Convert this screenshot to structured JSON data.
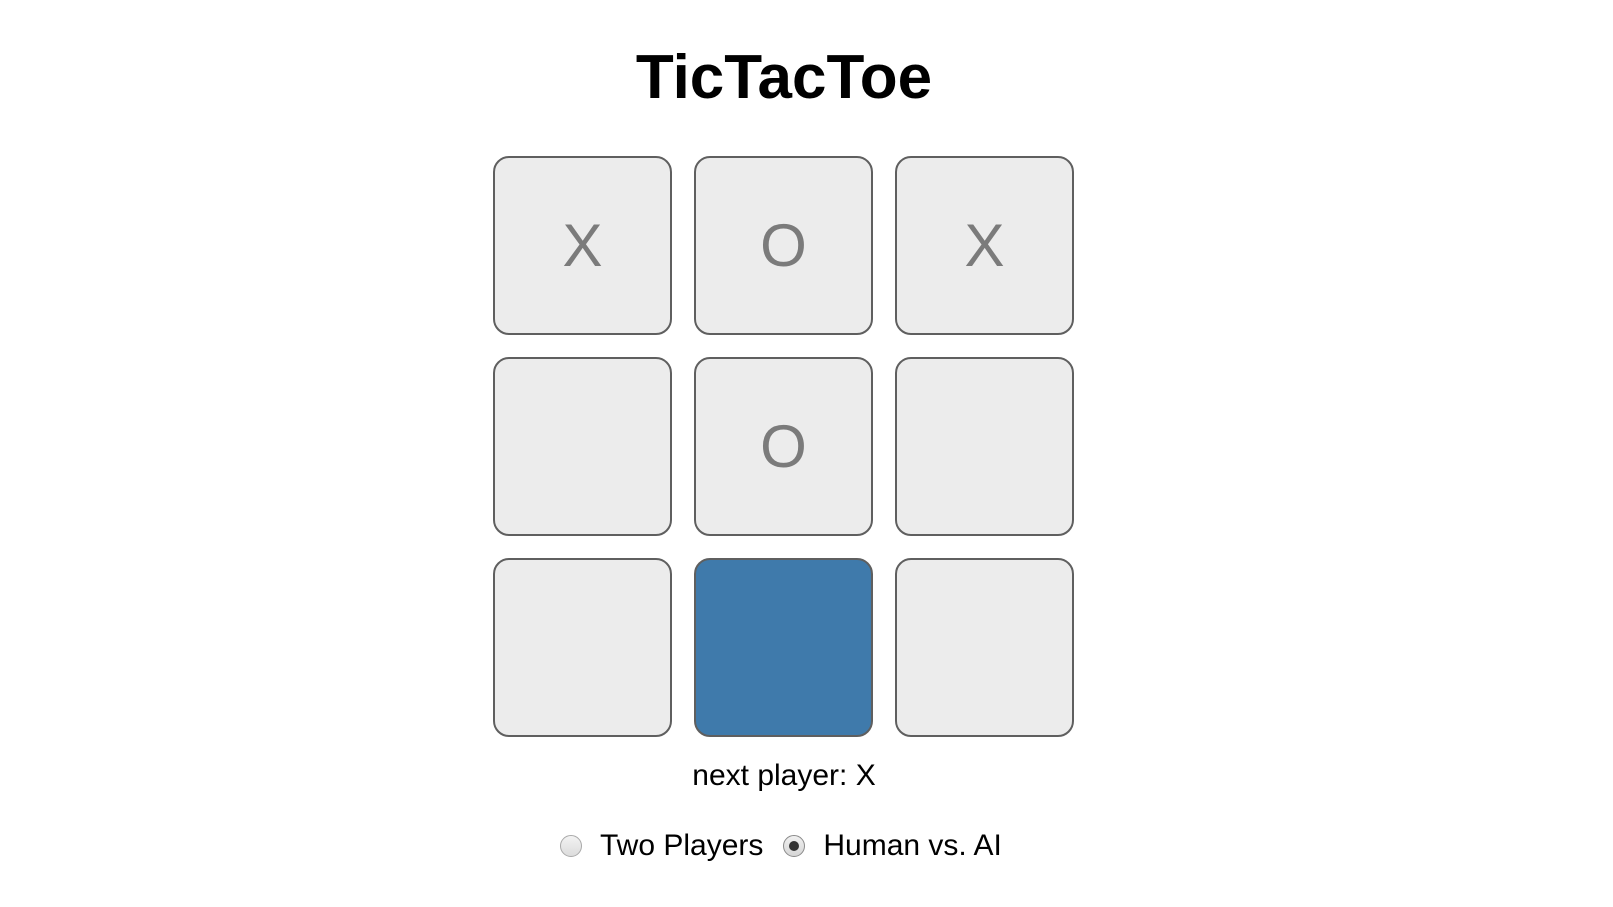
{
  "title": "TicTacToe",
  "board": {
    "cells": [
      "X",
      "O",
      "X",
      "",
      "O",
      "",
      "",
      "",
      ""
    ],
    "highlighted_cell": 7,
    "highlight_color": "#3f7aab",
    "cell_color": "#ececec",
    "mark_color": "#7b7b7b"
  },
  "status": {
    "text": "next player: X"
  },
  "modes": {
    "options": [
      {
        "label": "Two Players",
        "checked": false
      },
      {
        "label": "Human vs. AI",
        "checked": true
      }
    ]
  }
}
